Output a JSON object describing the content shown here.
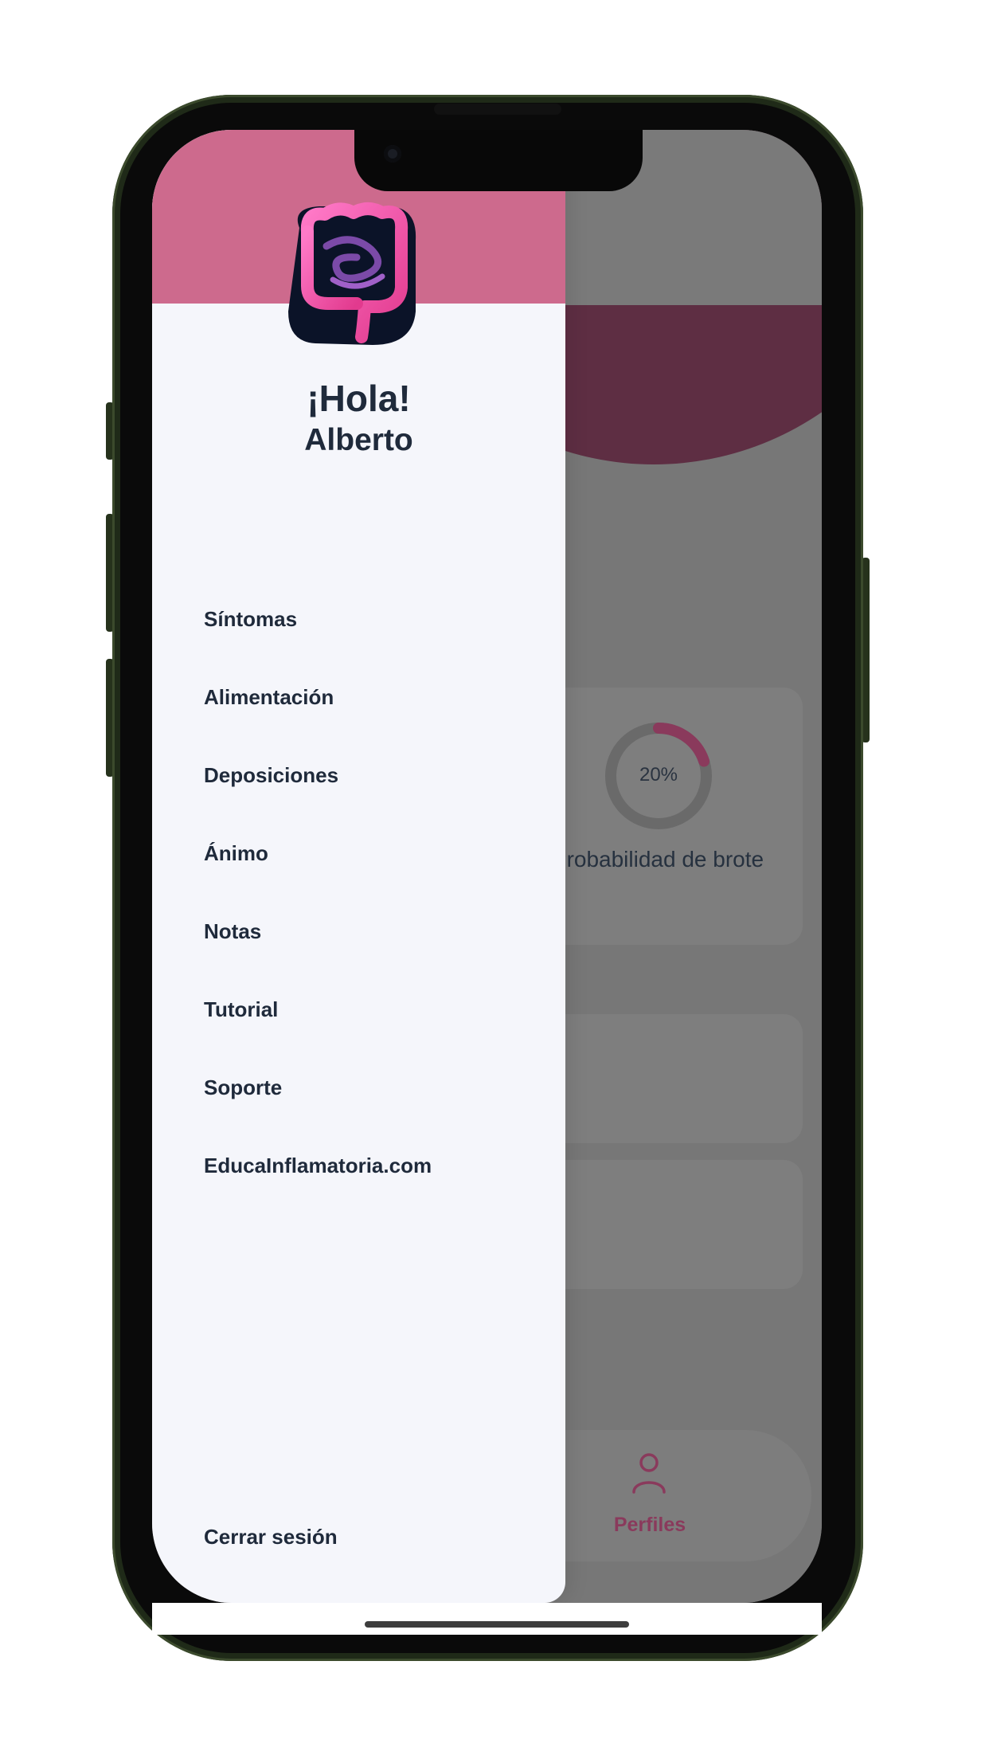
{
  "drawer": {
    "greeting": "¡Hola!",
    "user_name": "Alberto",
    "menu": [
      {
        "label": "Síntomas"
      },
      {
        "label": "Alimentación"
      },
      {
        "label": "Deposiciones"
      },
      {
        "label": "Ánimo"
      },
      {
        "label": "Notas"
      },
      {
        "label": "Tutorial"
      },
      {
        "label": "Soporte"
      },
      {
        "label": "EducaInflamatoria.com"
      }
    ],
    "logout_label": "Cerrar sesión",
    "logo": "intestine-logo-icon"
  },
  "background": {
    "probability_value": "20%",
    "probability_fraction": 0.2,
    "probability_label": "Probabilidad de brote",
    "tab_profiles_label": "Perfiles",
    "tab_profiles_icon": "person-icon"
  },
  "colors": {
    "drawer_header": "#cd6a8d",
    "accent": "#c04a78",
    "text_dark": "#1f2a3b"
  }
}
